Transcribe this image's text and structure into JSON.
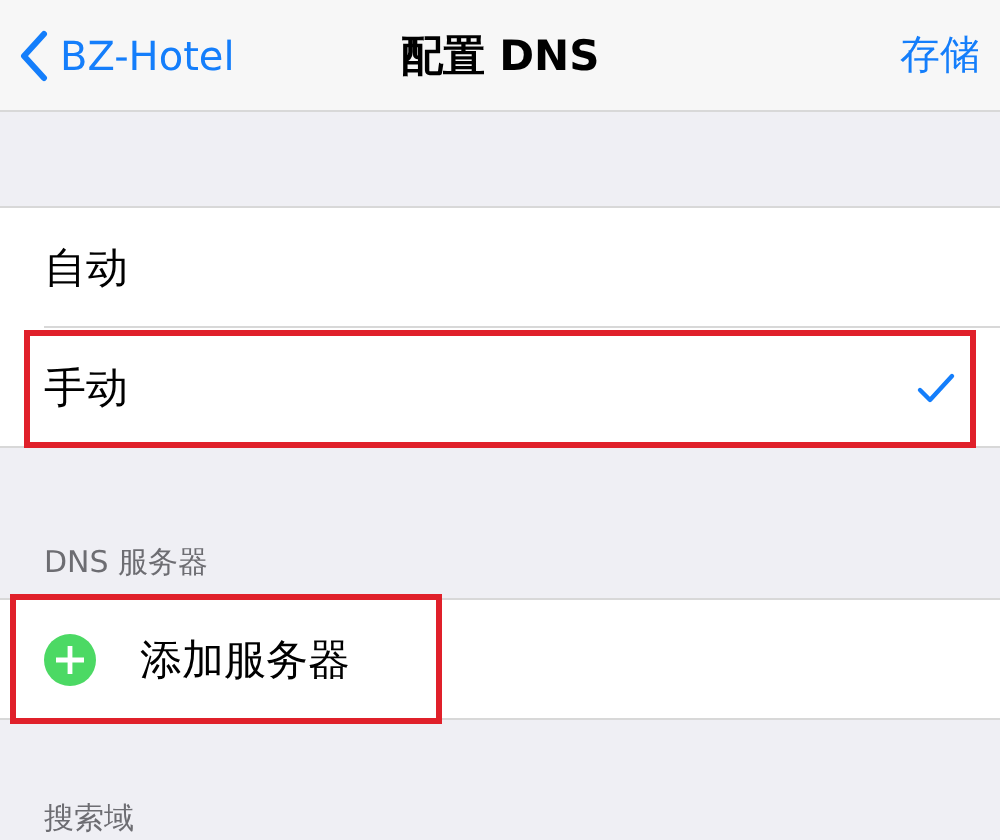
{
  "nav_bar": {
    "back": "BZ-Hotel",
    "title": "配置 DNS",
    "action": "存储"
  },
  "sections": [
    {
      "items": [
        {
          "kind": "option",
          "label": "自动",
          "selected": false,
          "highlighted": false
        },
        {
          "kind": "option",
          "label": "手动",
          "selected": true,
          "highlighted": true
        }
      ]
    },
    {
      "header": "DNS 服务器",
      "items": [
        {
          "kind": "add",
          "label": "添加服务器",
          "highlighted": true
        }
      ]
    },
    {
      "header": "搜索域"
    }
  ]
}
